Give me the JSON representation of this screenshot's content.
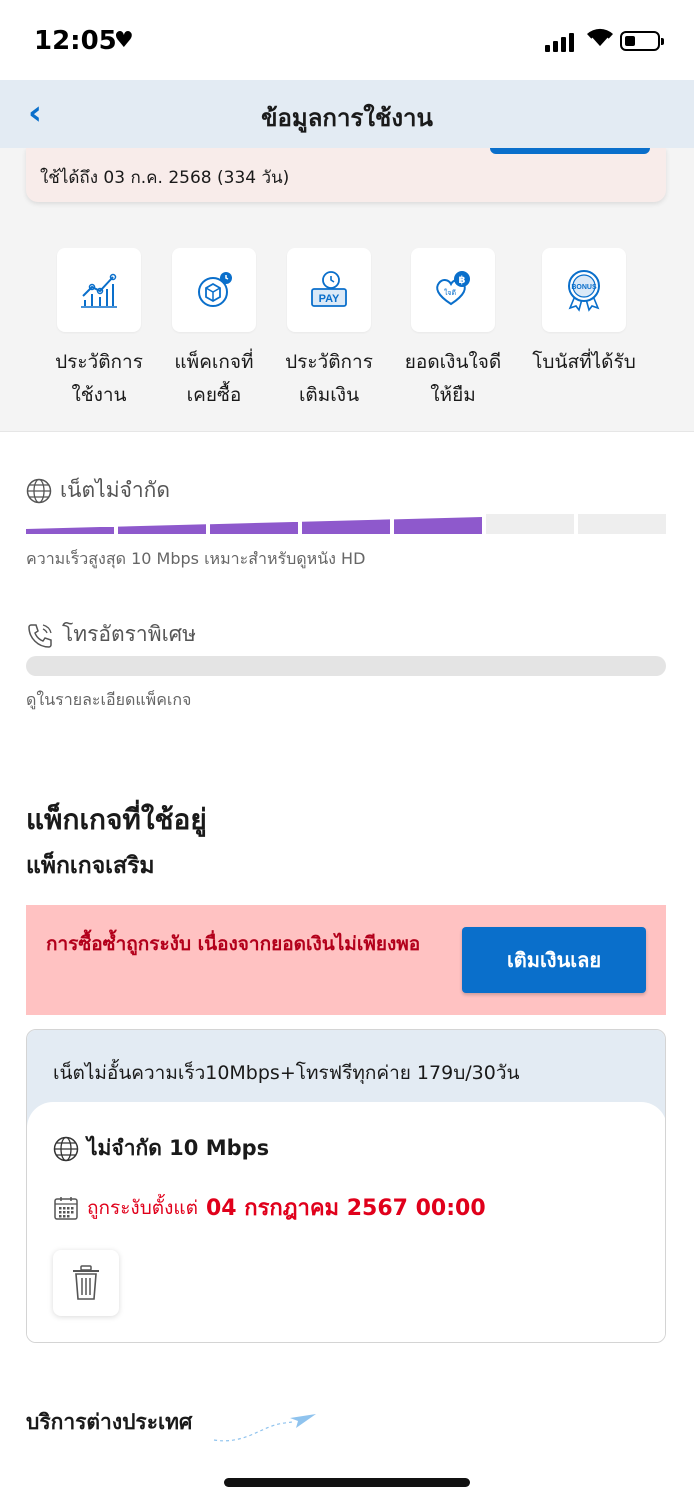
{
  "status_bar": {
    "time": "12:05",
    "heart": "♥"
  },
  "header": {
    "title": "ข้อมูลการใช้งาน",
    "back_icon": "‹"
  },
  "validity": {
    "text": "ใช้ได้ถึง 03 ก.ค. 2568 (334 วัน)"
  },
  "menu": [
    {
      "label": "ประวัติการ\nใช้งาน",
      "icon": "usage-chart-icon"
    },
    {
      "label": "แพ็คเกจที่\nเคยซื้อ",
      "icon": "package-history-icon"
    },
    {
      "label": "ประวัติการ\nเติมเงิน",
      "icon": "pay-history-icon"
    },
    {
      "label": "ยอดเงินใจดี\nให้ยืม",
      "icon": "loan-heart-icon"
    },
    {
      "label": "โบนัสที่ได้รับ",
      "icon": "bonus-badge-icon"
    }
  ],
  "internet": {
    "title": "เน็ตไม่จำกัด",
    "description": "ความเร็วสูงสุด 10 Mbps เหมาะสำหรับดูหนัง HD",
    "filled_segments": 5,
    "total_segments": 7
  },
  "call": {
    "title": "โทรอัตราพิเศษ",
    "description": "ดูในรายละเอียดแพ็คเกจ"
  },
  "packages": {
    "heading": "แพ็กเกจที่ใช้อยู่",
    "subheading": "แพ็กเกจเสริม",
    "alert": {
      "text": "การซื้อซ้ำถูกระงับ เนื่องจากยอดเงินไม่เพียงพอ",
      "button": "เติมเงินเลย"
    },
    "card": {
      "name": "เน็ตไม่อั้นความเร็ว10Mbps+โทรฟรีทุกค่าย 179บ/30วัน",
      "feature": "ไม่จำกัด 10 Mbps",
      "blocked_prefix": "ถูกระงับตั้งแต่",
      "blocked_date": "04 กรกฎาคม 2567 00:00"
    }
  },
  "international": {
    "title": "บริการต่างประเทศ"
  },
  "colors": {
    "accent": "#0a6fcb",
    "purple": "#8e59cc",
    "alert_bg": "#ffc2c2",
    "alert_text": "#b3001b",
    "danger": "#e0001b"
  }
}
